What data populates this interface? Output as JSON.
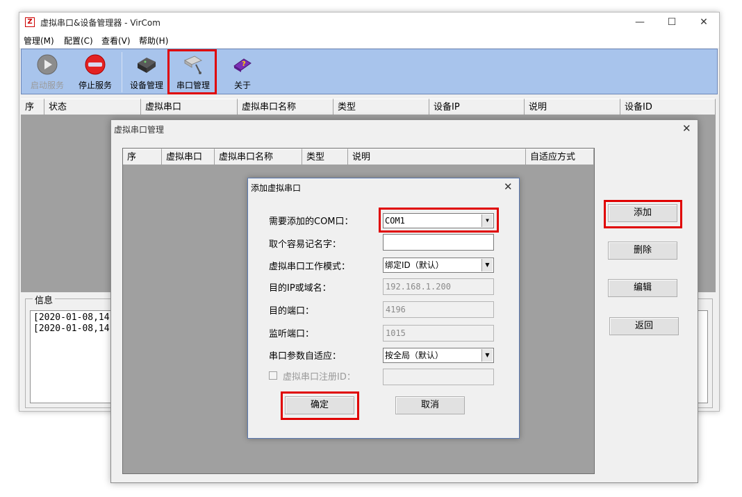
{
  "window": {
    "title": "虚拟串口&设备管理器 - VirCom",
    "icon_glyph": "Z",
    "minimize_glyph": "—",
    "maximize_glyph": "☐",
    "close_glyph": "✕"
  },
  "menu": [
    "管理(M)",
    "配置(C)",
    "查看(V)",
    "帮助(H)"
  ],
  "toolbar": {
    "start_service": "启动服务",
    "stop_service": "停止服务",
    "device_manage": "设备管理",
    "port_manage": "串口管理",
    "about": "关于"
  },
  "main_columns": [
    "序",
    "状态",
    "虚拟串口",
    "虚拟串口名称",
    "类型",
    "设备IP",
    "说明",
    "设备ID"
  ],
  "info": {
    "label": "信息",
    "lines": [
      "[2020-01-08,14:",
      "[2020-01-08,14:"
    ]
  },
  "port_dialog": {
    "title": "虚拟串口管理",
    "close_glyph": "✕",
    "columns": [
      "序",
      "虚拟串口",
      "虚拟串口名称",
      "类型",
      "说明",
      "自适应方式"
    ],
    "buttons": {
      "add": "添加",
      "delete": "删除",
      "edit": "编辑",
      "back": "返回"
    }
  },
  "add_dialog": {
    "title": "添加虚拟串口",
    "close_glyph": "✕",
    "labels": {
      "com": "需要添加的COM口：",
      "name": "取个容易记名字：",
      "mode": "虚拟串口工作模式：",
      "ip": "目的IP或域名：",
      "dest_port": "目的端口：",
      "listen_port": "监听端口：",
      "adapt": "串口参数自适应：",
      "reg_id": "虚拟串口注册ID："
    },
    "values": {
      "com": "COM1",
      "name": "",
      "mode": "绑定ID（默认）",
      "ip": "192.168.1.200",
      "dest_port": "4196",
      "listen_port": "1015",
      "adapt": "按全局（默认）",
      "reg_id": ""
    },
    "buttons": {
      "ok": "确定",
      "cancel": "取消"
    }
  },
  "colors": {
    "highlight": "#e00000",
    "toolbar_bg": "#a8c4ec"
  }
}
